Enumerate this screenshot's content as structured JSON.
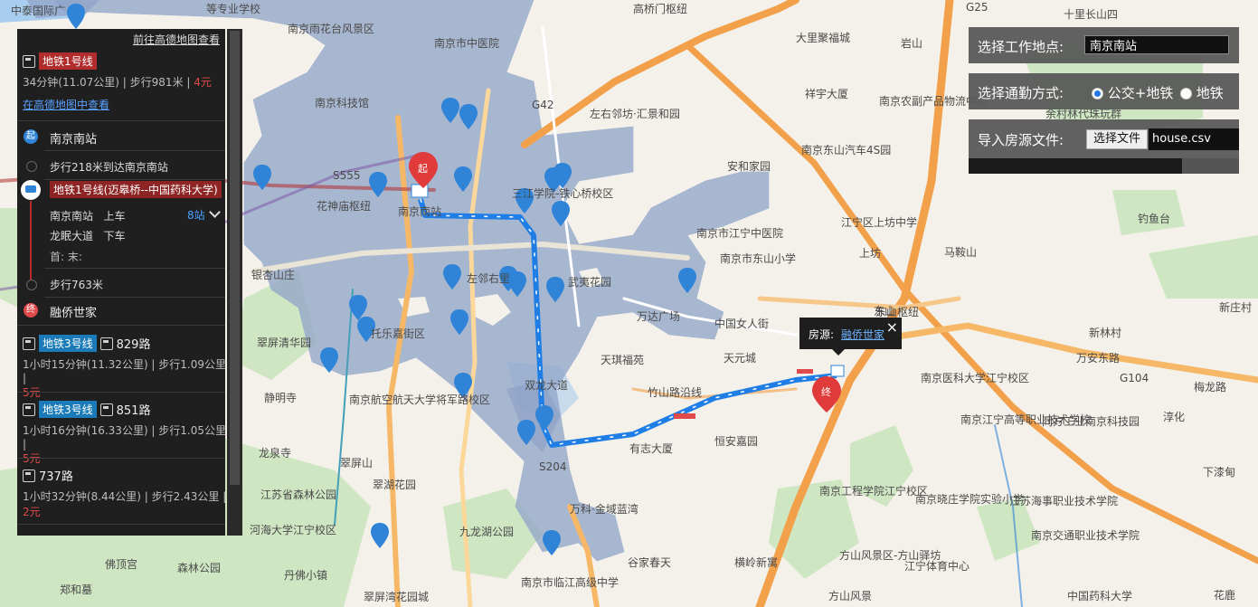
{
  "map": {
    "labels": [
      "中泰国际广",
      "等专业学校",
      "南京雨花台风景区",
      "南京市中医院",
      "高桥门枢纽",
      "大里聚福城",
      "岩山",
      "南京科技馆",
      "G42",
      "左右邻坊·汇景和园",
      "祥宇大厦",
      "南京农副产品物流中心",
      "南京东山汽车4S园",
      "安和家园",
      "花神庙枢纽",
      "南京南站",
      "三江学院-铁心桥校区",
      "南京市江宁中医院",
      "南京市东山小学",
      "江宁区上坊中学",
      "马鞍山",
      "钓鱼台",
      "银杏山庄",
      "左邻右里",
      "武夷花园",
      "万达广场",
      "中国女人街",
      "东山枢纽",
      "翠屏清华园",
      "托乐嘉街区",
      "天琪福苑",
      "天元城",
      "竹山路沿线",
      "双龙大道",
      "南京医科大学江宁校区",
      "万安东路",
      "梅龙路",
      "静明寺",
      "南京航空航天大学将军路校区",
      "南京江宁高等职业技术学校",
      "同方工业南京科技园",
      "淳化",
      "龙泉寺",
      "有志大厦",
      "恒安嘉园",
      "翠屏山",
      "翠湖花园",
      "江苏省森林公园",
      "南京工程学院江宁校区",
      "南京晓庄学院实验小学",
      "江苏海事职业技术学院",
      "河海大学江宁校区",
      "九龙湖公园",
      "万科·金域蓝湾",
      "南京交通职业技术学院",
      "佛顶宫",
      "森林公园",
      "郑和墓",
      "丹佛小镇",
      "翠屏湾花园城",
      "谷家春天",
      "横岭新寓",
      "方山风景区-方山驿坊",
      "江宁体育中心",
      "南京市临江高级中学",
      "方山风景",
      "中国药科大学",
      "花鹿",
      "新林村",
      "下漆甸",
      "新庄村",
      "十里长山四",
      "余村林代珠玩群",
      "东山",
      "上坊",
      "G25",
      "S555",
      "G104",
      "S204",
      "起",
      "终"
    ]
  },
  "route_panel": {
    "top_link": "前往高德地图查看",
    "selected": {
      "line": "地铁1号线",
      "summary": "34分钟(11.07公里) | 步行981米 | ",
      "price": "4元",
      "detail_link": "在高德地图中查看",
      "start_label": "起",
      "start": "南京南站",
      "walk1": "步行218米到达南京南站",
      "line_full": "地铁1号线(迈皋桥--中国药科大学)",
      "board_station": "南京南站",
      "board_action": "上车",
      "stops": "8站",
      "alight_station": "龙眠大道",
      "alight_action": "下车",
      "first_last": "首: 末:",
      "walk2": "步行763米",
      "end_label": "终",
      "end": "融侨世家"
    },
    "routes": [
      {
        "line": "地铁3号线",
        "bus": "829路",
        "summary": "1小时15分钟(11.32公里) | 步行1.09公里 | ",
        "price": "5元"
      },
      {
        "line": "地铁3号线",
        "bus": "851路",
        "summary": "1小时16分钟(16.33公里) | 步行1.05公里 | ",
        "price": "5元"
      },
      {
        "bus": "737路",
        "summary": "1小时32分钟(8.44公里) | 步行2.43公里 | ",
        "price": "2元"
      }
    ]
  },
  "controls": {
    "work_label": "选择工作地点:",
    "work_value": "南京南站",
    "mode_label": "选择通勤方式:",
    "mode_options": [
      "公交+地铁",
      "地铁"
    ],
    "mode_selected": "公交+地铁",
    "file_label": "导入房源文件:",
    "file_button": "选择文件",
    "file_name": "house.csv",
    "progress_fraction": 0.79
  },
  "popup": {
    "label": "房源:",
    "link": "融侨世家",
    "close": "×"
  },
  "colors": {
    "hex_fill": "#8fa3c7",
    "route_blue": "#1f7ee6",
    "highway": "#f2a04a",
    "panel_bg": "#1f1f1f",
    "badge_red": "#b12d2d",
    "badge_blue": "#1a7bb8"
  }
}
